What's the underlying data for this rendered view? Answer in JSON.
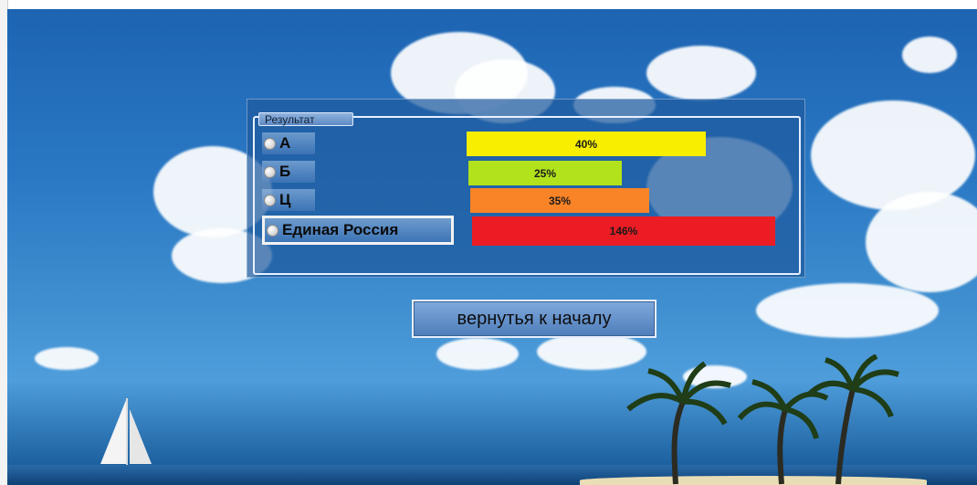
{
  "results": {
    "legend": "Результат",
    "options": [
      {
        "label": "А",
        "percent": "40%",
        "value": 40,
        "color": "#f7ee00"
      },
      {
        "label": "Б",
        "percent": "25%",
        "value": 25,
        "color": "#b2e21c"
      },
      {
        "label": "Ц",
        "percent": "35%",
        "value": 35,
        "color": "#f88427"
      },
      {
        "label": "Единая Россия",
        "percent": "146%",
        "value": 146,
        "color": "#eb1c24"
      }
    ]
  },
  "actions": {
    "back_label": "вернутья к началу"
  }
}
